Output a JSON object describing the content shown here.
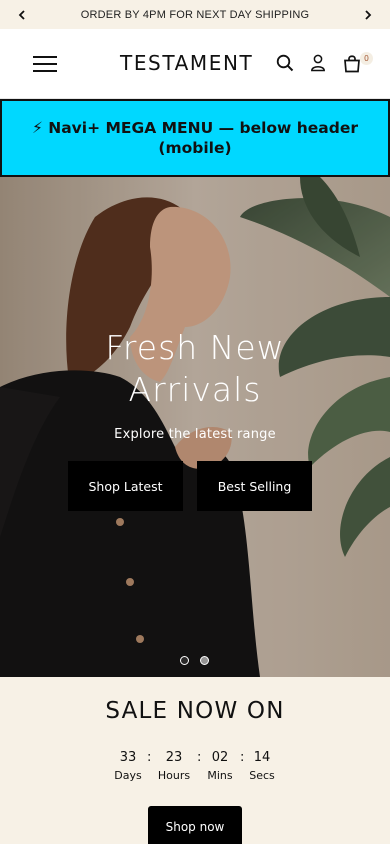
{
  "announcement": {
    "text": "ORDER BY 4PM FOR NEXT DAY SHIPPING"
  },
  "header": {
    "brand": "TESTAMENT",
    "cart_count": "0"
  },
  "mega_menu_banner": {
    "text": "⚡ Navi+ MEGA MENU — below header (mobile)"
  },
  "hero": {
    "title": "Fresh New Arrivals",
    "subtitle": "Explore the latest range",
    "buttons": {
      "primary": "Shop Latest",
      "secondary": "Best Selling"
    },
    "slides": 2,
    "active_slide": 2
  },
  "sale": {
    "title": "SALE NOW ON",
    "countdown": {
      "days": "33",
      "hours": "23",
      "mins": "02",
      "secs": "14",
      "labels": {
        "days": "Days",
        "hours": "Hours",
        "mins": "Mins",
        "secs": "Secs"
      },
      "separator": ":"
    },
    "cta": "Shop now"
  },
  "colors": {
    "announce_bg": "#f7f1e6",
    "megabar_bg": "#00d8ff",
    "button_bg": "#000000",
    "sale_bg": "#f7f1e6"
  }
}
